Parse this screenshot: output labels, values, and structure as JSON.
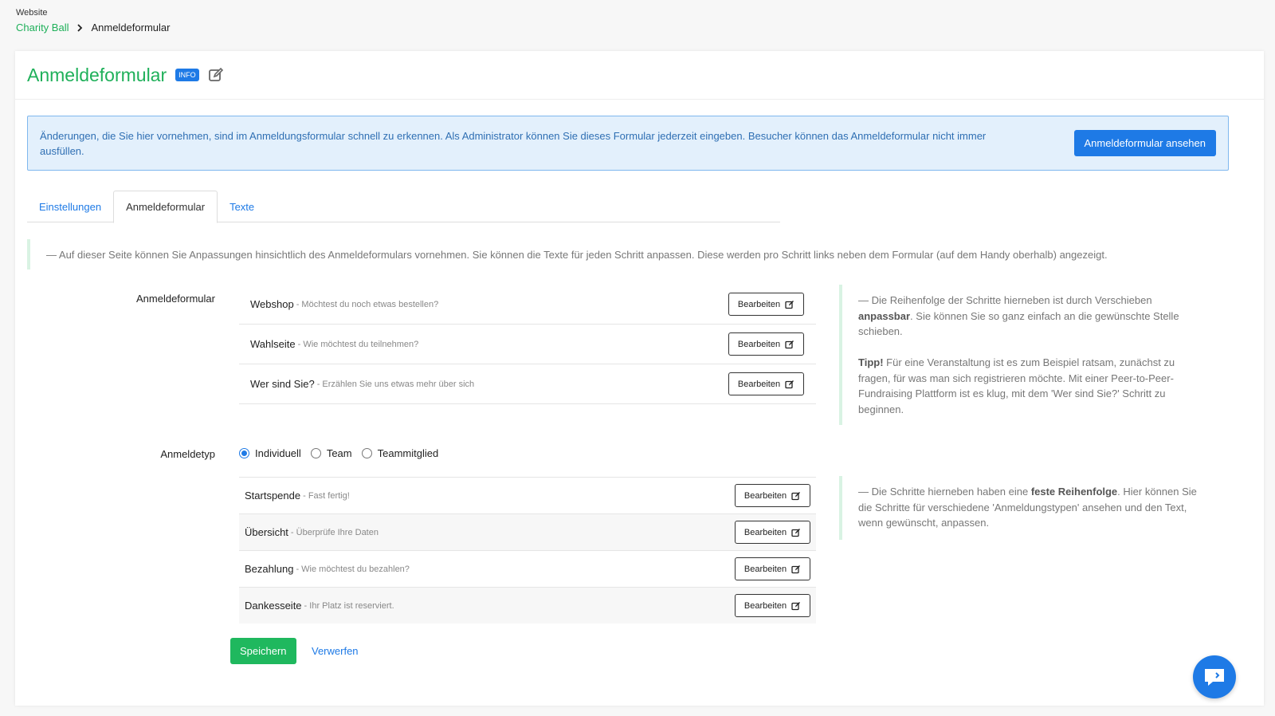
{
  "breadcrumb": {
    "section": "Website",
    "parent": "Charity Ball",
    "current": "Anmeldeformular"
  },
  "header": {
    "title": "Anmeldeformular",
    "badge": "INFO",
    "edit_icon": "edit-icon"
  },
  "info": {
    "text": "Änderungen, die Sie hier vornehmen, sind im Anmeldungsformular schnell zu erkennen. Als Administrator können Sie dieses Formular jederzeit eingeben. Besucher können das Anmeldeformular nicht immer ausfüllen.",
    "button": "Anmeldeformular ansehen"
  },
  "tabs": [
    {
      "label": "Einstellungen",
      "active": false
    },
    {
      "label": "Anmeldeformular",
      "active": true
    },
    {
      "label": "Texte",
      "active": false
    }
  ],
  "hint": "— Auf dieser Seite können Sie Anpassungen hinsichtlich des Anmeldeformulars vornehmen. Sie können die Texte für jeden Schritt anpassen. Diese werden pro Schritt links neben dem Formular (auf dem Handy oberhalb) angezeigt.",
  "form": {
    "label": "Anmeldeformular",
    "edit_label": "Bearbeiten",
    "steps": [
      {
        "title": "Webshop",
        "subtitle": "- Möchtest du noch etwas bestellen?"
      },
      {
        "title": "Wahlseite",
        "subtitle": "- Wie möchtest du teilnehmen?"
      },
      {
        "title": "Wer sind Sie?",
        "subtitle": "- Erzählen Sie uns etwas mehr über sich"
      }
    ],
    "note": {
      "p1_a": "— Die Reihenfolge der Schritte hierneben ist durch Verschieben",
      "p1_b": "anpassbar",
      "p1_c": ". Sie können Sie so ganz einfach an die gewünschte Stelle schieben.",
      "p2_a": "Tipp!",
      "p2_b": " Für eine Veranstaltung ist es zum Beispiel ratsam, zunächst zu fragen, für was man sich registrieren möchte. Mit einer Peer-to-Peer-Fundraising Plattform ist es klug, mit dem 'Wer sind Sie?' Schritt zu beginnen."
    }
  },
  "type": {
    "label": "Anmeldetyp",
    "options": [
      {
        "label": "Individuell",
        "selected": true
      },
      {
        "label": "Team",
        "selected": false
      },
      {
        "label": "Teammitglied",
        "selected": false
      }
    ],
    "steps": [
      {
        "title": "Startspende",
        "subtitle": "- Fast fertig!"
      },
      {
        "title": "Übersicht",
        "subtitle": "- Überprüfe Ihre Daten"
      },
      {
        "title": "Bezahlung",
        "subtitle": "- Wie möchtest du bezahlen?"
      },
      {
        "title": "Dankesseite",
        "subtitle": "- Ihr Platz ist reserviert."
      }
    ],
    "note": {
      "a": "— Die Schritte hierneben haben eine ",
      "b": "feste Reihenfolge",
      "c": ". Hier können Sie die Schritte für verschiedene 'Anmeldungstypen' ansehen und den Text, wenn gewünscht, anpassen."
    }
  },
  "actions": {
    "save": "Speichern",
    "discard": "Verwerfen"
  },
  "colors": {
    "brand_green": "#1fb05a",
    "primary_blue": "#1e7ae6",
    "info_bg": "#e3f0fc"
  }
}
